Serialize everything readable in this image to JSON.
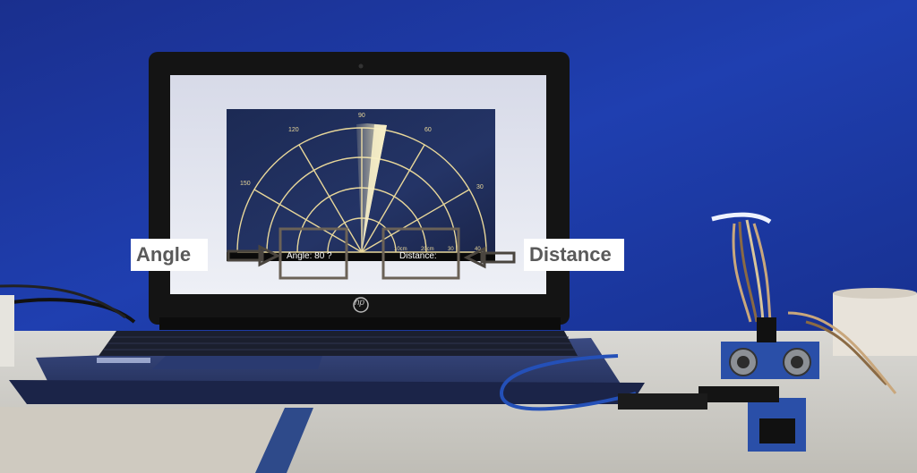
{
  "annotations": {
    "angle_label": "Angle",
    "distance_label": "Distance"
  },
  "radar": {
    "angle_readout": "Angle: 80 ?",
    "distance_readout": "Distance:",
    "angle_ticks": [
      "30",
      "60",
      "90",
      "120",
      "150"
    ],
    "range_ticks": [
      "10cm",
      "20cm",
      "30",
      "40"
    ]
  },
  "laptop": {
    "logo": "hp"
  },
  "colors": {
    "wall": "#1c3aa0",
    "radar_line": "#e8d79a",
    "sweep": "#f2e7b5",
    "annotation_box": "#6b6257"
  }
}
